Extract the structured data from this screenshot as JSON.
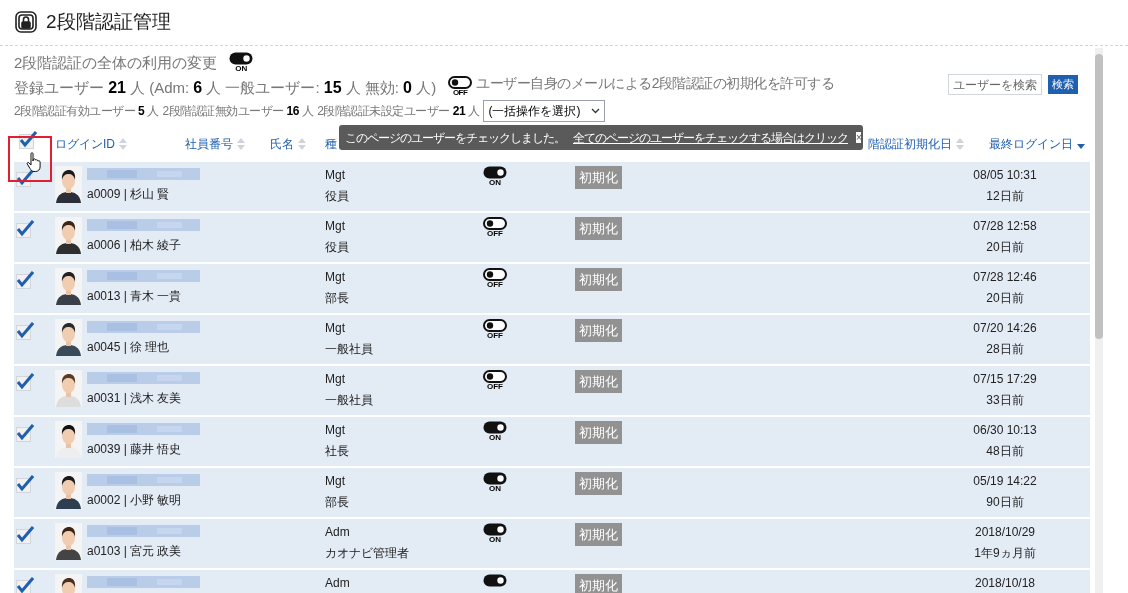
{
  "title": "2段階認証管理",
  "global_toggle": {
    "label": "2段階認証の全体の利用の変更",
    "on": true,
    "state_text": "ON"
  },
  "stats": [
    {
      "text": "登録ユーザー",
      "strong": "21",
      "unit": "人"
    },
    {
      "text": "(Adm:",
      "strong": "6",
      "unit": "人"
    },
    {
      "text": "一般ユーザー:",
      "strong": "15",
      "unit": "人"
    },
    {
      "text": "無効:",
      "strong": "0",
      "unit": "人)"
    }
  ],
  "self_reset_toggle": {
    "label": "ユーザー自身のメールによる2段階認証の初期化を許可する",
    "on": false,
    "state_text": "OFF"
  },
  "substats": [
    {
      "text": "2段階認証有効ユーザー",
      "strong": "5",
      "unit": "人"
    },
    {
      "text": "2段階認証無効ユーザー",
      "strong": "16",
      "unit": "人"
    },
    {
      "text": "2段階認証未設定ユーザー",
      "strong": "21",
      "unit": "人"
    }
  ],
  "bulk_select": {
    "value": "(一括操作を選択)"
  },
  "search": {
    "placeholder": "ユーザーを検索",
    "button": "検索"
  },
  "header_checkbox": {
    "checked": true
  },
  "columns": [
    {
      "label": "ログインID",
      "sorted": false
    },
    {
      "label": "社員番号",
      "sorted": false
    },
    {
      "label": "氏名",
      "sorted": false
    },
    {
      "label": "種"
    },
    {
      "label": "階認証初期化日",
      "sorted": false
    },
    {
      "label": "最終ログイン日",
      "sorted": true
    }
  ],
  "tooltip": {
    "message": "このページのユーザーをチェックしました。",
    "link": "全てのページのユーザーをチェックする場合はクリック",
    "close": "×"
  },
  "rows": [
    {
      "checked": true,
      "user": "a0009 | 杉山 賢",
      "type": "Mgt",
      "role": "役員",
      "tfa_on": true,
      "tfa_text": "ON",
      "reset": "初期化",
      "date": "08/05 10:31",
      "ago": "12日前"
    },
    {
      "checked": true,
      "user": "a0006 | 柏木 綾子",
      "type": "Mgt",
      "role": "役員",
      "tfa_on": false,
      "tfa_text": "OFF",
      "reset": "初期化",
      "date": "07/28 12:58",
      "ago": "20日前"
    },
    {
      "checked": true,
      "user": "a0013 | 青木 一貴",
      "type": "Mgt",
      "role": "部長",
      "tfa_on": false,
      "tfa_text": "OFF",
      "reset": "初期化",
      "date": "07/28 12:46",
      "ago": "20日前"
    },
    {
      "checked": true,
      "user": "a0045 | 徐 理也",
      "type": "Mgt",
      "role": "一般社員",
      "tfa_on": false,
      "tfa_text": "OFF",
      "reset": "初期化",
      "date": "07/20 14:26",
      "ago": "28日前"
    },
    {
      "checked": true,
      "user": "a0031 | 浅木 友美",
      "type": "Mgt",
      "role": "一般社員",
      "tfa_on": false,
      "tfa_text": "OFF",
      "reset": "初期化",
      "date": "07/15 17:29",
      "ago": "33日前"
    },
    {
      "checked": true,
      "user": "a0039 | 藤井 悟史",
      "type": "Mgt",
      "role": "社長",
      "tfa_on": true,
      "tfa_text": "ON",
      "reset": "初期化",
      "date": "06/30 10:13",
      "ago": "48日前"
    },
    {
      "checked": true,
      "user": "a0002 | 小野 敏明",
      "type": "Mgt",
      "role": "部長",
      "tfa_on": true,
      "tfa_text": "ON",
      "reset": "初期化",
      "date": "05/19 14:22",
      "ago": "90日前"
    },
    {
      "checked": true,
      "user": "a0103 | 宮元 政美",
      "type": "Adm",
      "role": "カオナビ管理者",
      "tfa_on": true,
      "tfa_text": "ON",
      "reset": "初期化",
      "date": "2018/10/29",
      "ago": "1年9ヵ月前"
    },
    {
      "checked": true,
      "type": "Adm",
      "tfa_on": true,
      "reset": "初期化",
      "date": "2018/10/18"
    }
  ]
}
